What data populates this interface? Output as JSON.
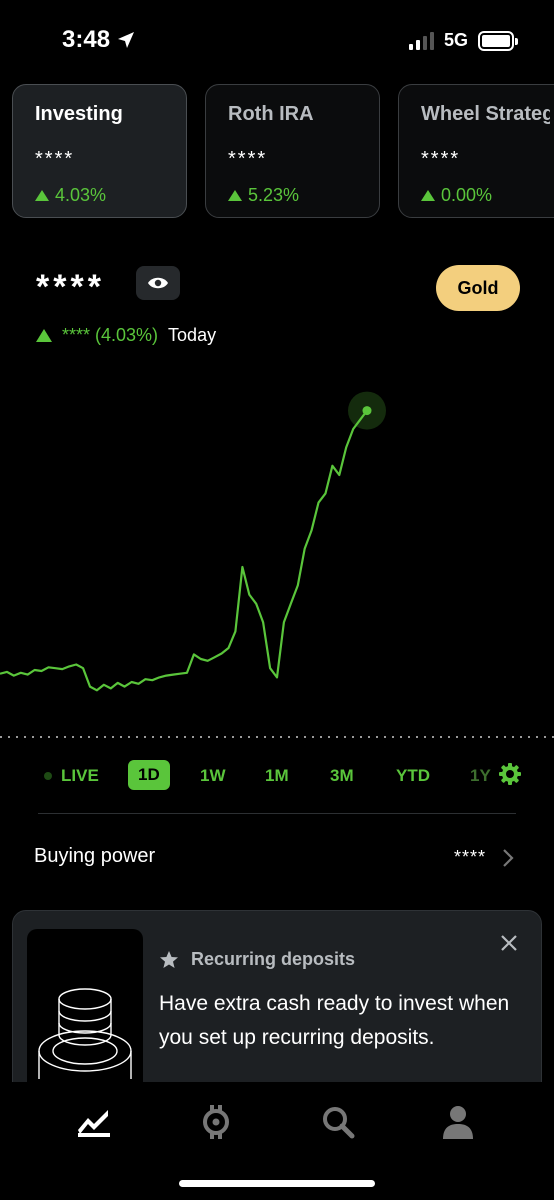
{
  "status_bar": {
    "time": "3:48",
    "network": "5G"
  },
  "accounts": [
    {
      "name": "Investing",
      "value": "****",
      "change": "4.03%",
      "active": true
    },
    {
      "name": "Roth IRA",
      "value": "****",
      "change": "5.23%",
      "active": false
    },
    {
      "name": "Wheel Strateg",
      "value": "****",
      "change": "0.00%",
      "active": false
    }
  ],
  "portfolio": {
    "value": "****",
    "gold_label": "Gold",
    "today_amount": "**** (4.03%)",
    "today_label": "Today"
  },
  "chart_data": {
    "type": "line",
    "color": "#5ac53b",
    "baseline_style": "dotted",
    "y": [
      34,
      36,
      32,
      35,
      33,
      38,
      37,
      41,
      40,
      39,
      42,
      44,
      40,
      20,
      16,
      22,
      18,
      24,
      20,
      25,
      23,
      28,
      27,
      30,
      32,
      33,
      34,
      35,
      55,
      50,
      48,
      52,
      56,
      62,
      80,
      150,
      120,
      110,
      90,
      40,
      30,
      90,
      110,
      130,
      170,
      190,
      220,
      230,
      260,
      250,
      280,
      300,
      310,
      320
    ]
  },
  "ranges": {
    "live": "LIVE",
    "items": [
      "1D",
      "1W",
      "1M",
      "3M",
      "YTD",
      "1Y"
    ],
    "active": "1D"
  },
  "buying_power": {
    "label": "Buying power",
    "value": "****"
  },
  "recurring": {
    "title": "Recurring deposits",
    "body": "Have extra cash ready to invest when you set up recurring deposits."
  },
  "nav": [
    "chart-icon",
    "crypto-icon",
    "search-icon",
    "account-icon"
  ]
}
